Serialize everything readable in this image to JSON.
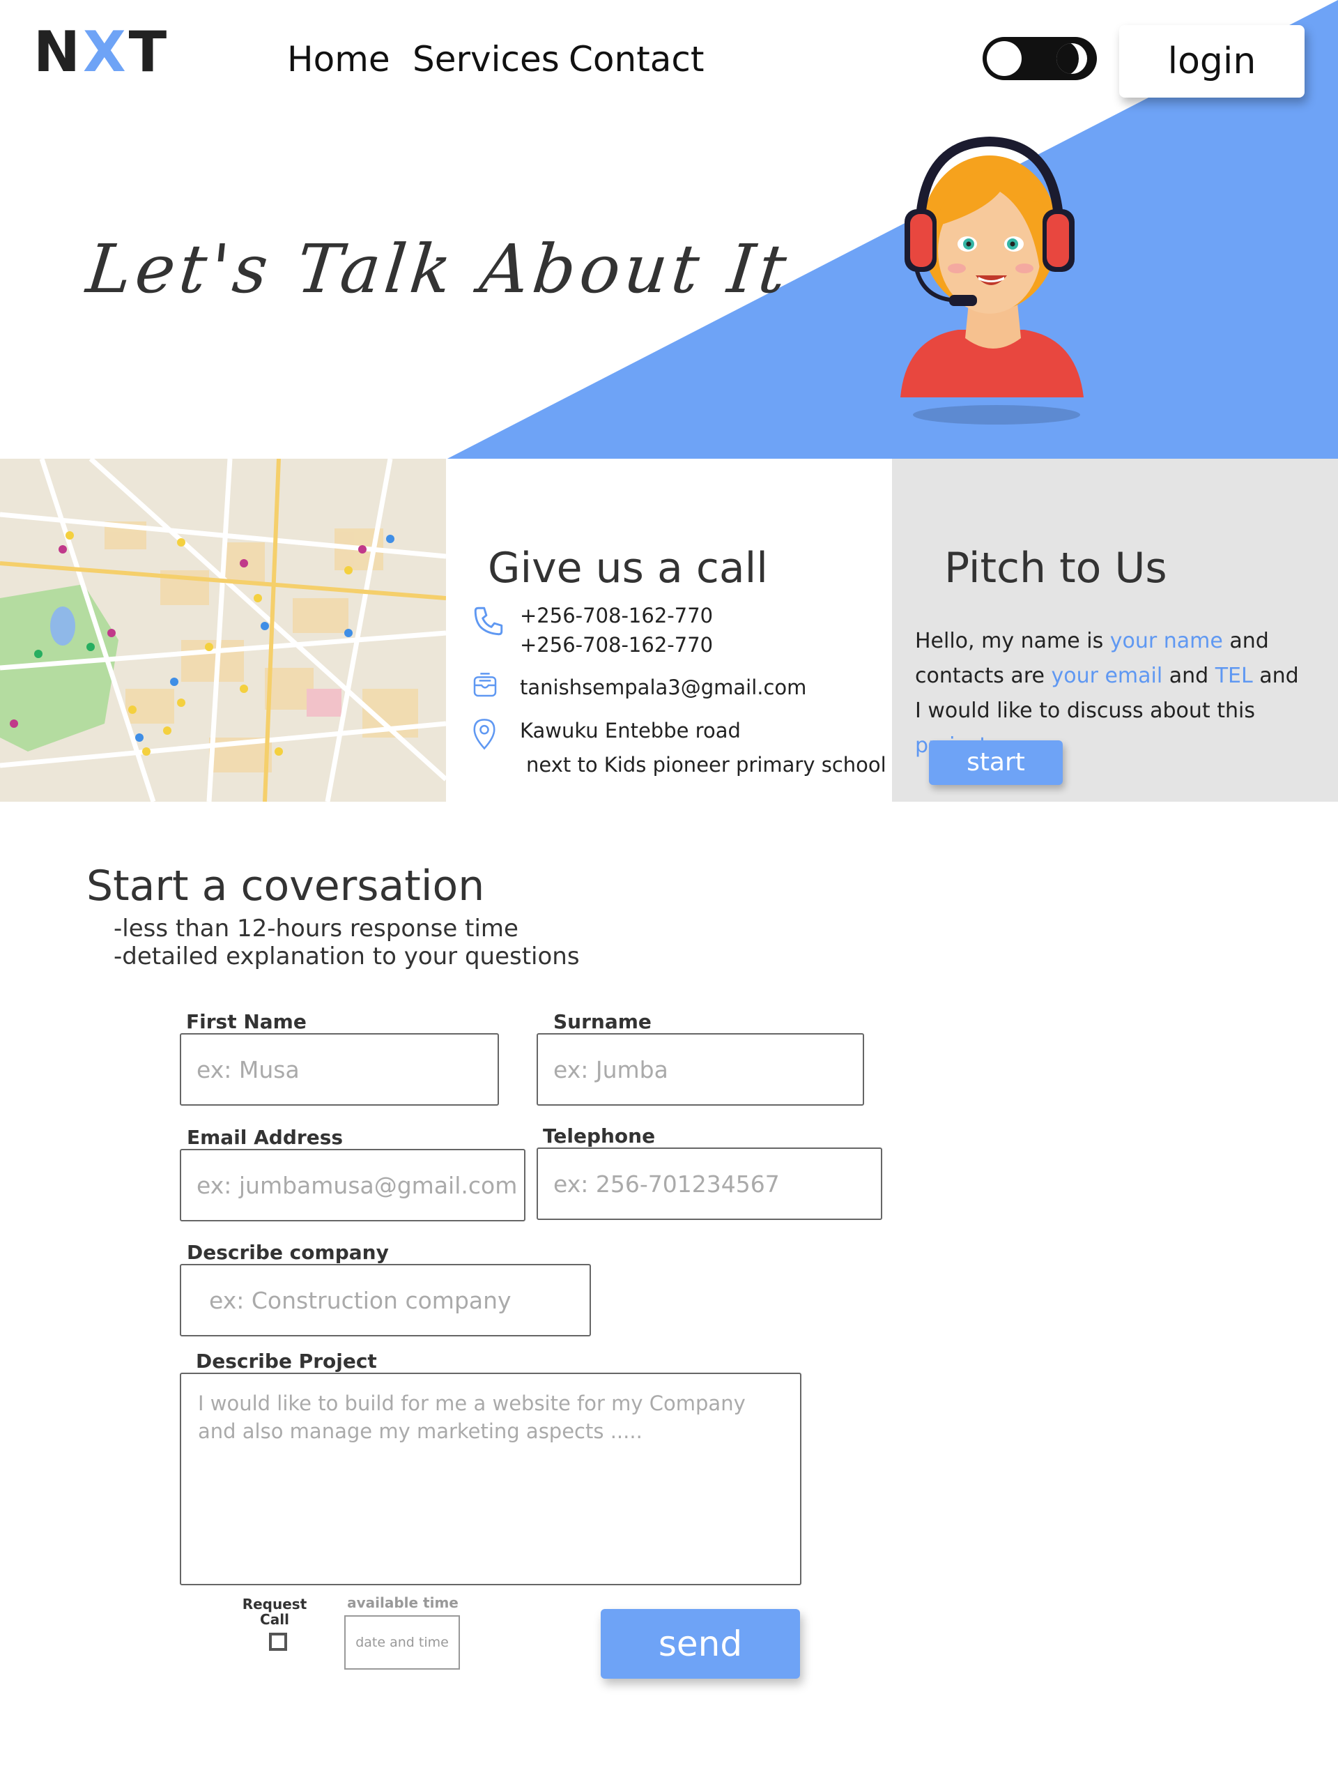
{
  "header": {
    "logo": {
      "left": "N",
      "mid": "X",
      "right": "T"
    },
    "nav": [
      "Home",
      "Services",
      "Contact"
    ],
    "login_label": "login"
  },
  "hero": {
    "title": "Let's Talk About It"
  },
  "call": {
    "title": "Give us a call",
    "phone1": "+256-708-162-770",
    "phone2": "+256-708-162-770",
    "email": "tanishsempala3@gmail.com",
    "address1": "Kawuku Entebbe road",
    "address2": "next to Kids pioneer primary school"
  },
  "pitch": {
    "title": "Pitch to Us",
    "t1": "Hello, my name is ",
    "name": "your name",
    "t2": " and contacts are ",
    "email": "your email",
    "t3": " and ",
    "tel": "TEL",
    "t4": " and I would like to discuss about this ",
    "project": "project",
    "start_label": "start"
  },
  "conversation": {
    "title": "Start a coversation",
    "bullets": [
      "-less than 12-hours response time",
      "-detailed explanation to your questions"
    ]
  },
  "form": {
    "first_name": {
      "label": "First Name",
      "placeholder": "ex:  Musa"
    },
    "surname": {
      "label": "Surname",
      "placeholder": "ex:  Jumba"
    },
    "email": {
      "label": "Email Address",
      "placeholder": "ex:  jumbamusa@gmail.com"
    },
    "telephone": {
      "label": "Telephone",
      "placeholder": "ex:  256-701234567"
    },
    "company": {
      "label": "Describe company",
      "placeholder": "ex:  Construction company"
    },
    "project": {
      "label": "Describe Project",
      "placeholder": "I would like to build for me a website for my Company and also manage my marketing aspects ....."
    },
    "request_call_label": "Request Call",
    "available_time_label": "available time",
    "date_placeholder": "date and time",
    "send_label": "send"
  },
  "colors": {
    "accent": "#6ea3f6",
    "pitch_bg": "#e4e4e4",
    "text": "#333333"
  }
}
